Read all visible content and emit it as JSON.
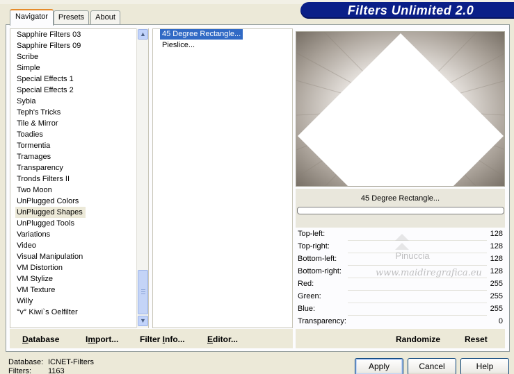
{
  "header": {
    "title": "Filters Unlimited 2.0"
  },
  "tabs": [
    {
      "label": "Navigator",
      "active": true
    },
    {
      "label": "Presets",
      "active": false
    },
    {
      "label": "About",
      "active": false
    }
  ],
  "filter_list": {
    "items": [
      "Sapphire Filters 03",
      "Sapphire Filters 09",
      "Scribe",
      "Simple",
      "Special Effects 1",
      "Special Effects 2",
      "Sybia",
      "Teph's Tricks",
      "Tile & Mirror",
      "Toadies",
      "Tormentia",
      "Tramages",
      "Transparency",
      "Tronds Filters II",
      "Two Moon",
      "UnPlugged Colors",
      "UnPlugged Shapes",
      "UnPlugged Tools",
      "Variations",
      "Video",
      "Visual Manipulation",
      "VM Distortion",
      "VM Stylize",
      "VM Texture",
      "Willy",
      "°v° Kiwi`s Oelfilter"
    ],
    "selected": "UnPlugged Shapes"
  },
  "effect_list": {
    "items": [
      "45 Degree Rectangle...",
      "Pieslice..."
    ],
    "selected": "45 Degree Rectangle..."
  },
  "preview": {
    "effect_name": "45 Degree Rectangle..."
  },
  "params": [
    {
      "label": "Top-left:",
      "value": "128"
    },
    {
      "label": "Top-right:",
      "value": "128"
    },
    {
      "label": "Bottom-left:",
      "value": "128"
    },
    {
      "label": "Bottom-right:",
      "value": "128"
    },
    {
      "label": "Red:",
      "value": "255"
    },
    {
      "label": "Green:",
      "value": "255"
    },
    {
      "label": "Blue:",
      "value": "255"
    },
    {
      "label": "Transparency:",
      "value": "0"
    }
  ],
  "watermark": {
    "line1": "Pinuccia",
    "line2": "www.maidiregrafica.eu"
  },
  "left_actions": {
    "database": {
      "u": "D",
      "rest": "atabase"
    },
    "import": {
      "pre": "I",
      "u": "m",
      "rest": "port..."
    },
    "filter_info": {
      "pre": "Filter ",
      "u": "I",
      "rest": "nfo..."
    },
    "editor": {
      "u": "E",
      "rest": "ditor..."
    }
  },
  "right_actions": {
    "randomize": "Randomize",
    "reset": "Reset"
  },
  "status": {
    "database_label": "Database:",
    "database_value": "ICNET-Filters",
    "filters_label": "Filters:",
    "filters_value": "1163"
  },
  "buttons": {
    "apply": "Apply",
    "cancel": "Cancel",
    "help": "Help"
  },
  "colors": {
    "banner": "#0a1f88",
    "selection": "#316ac5",
    "tab_accent": "#e68b2c"
  }
}
